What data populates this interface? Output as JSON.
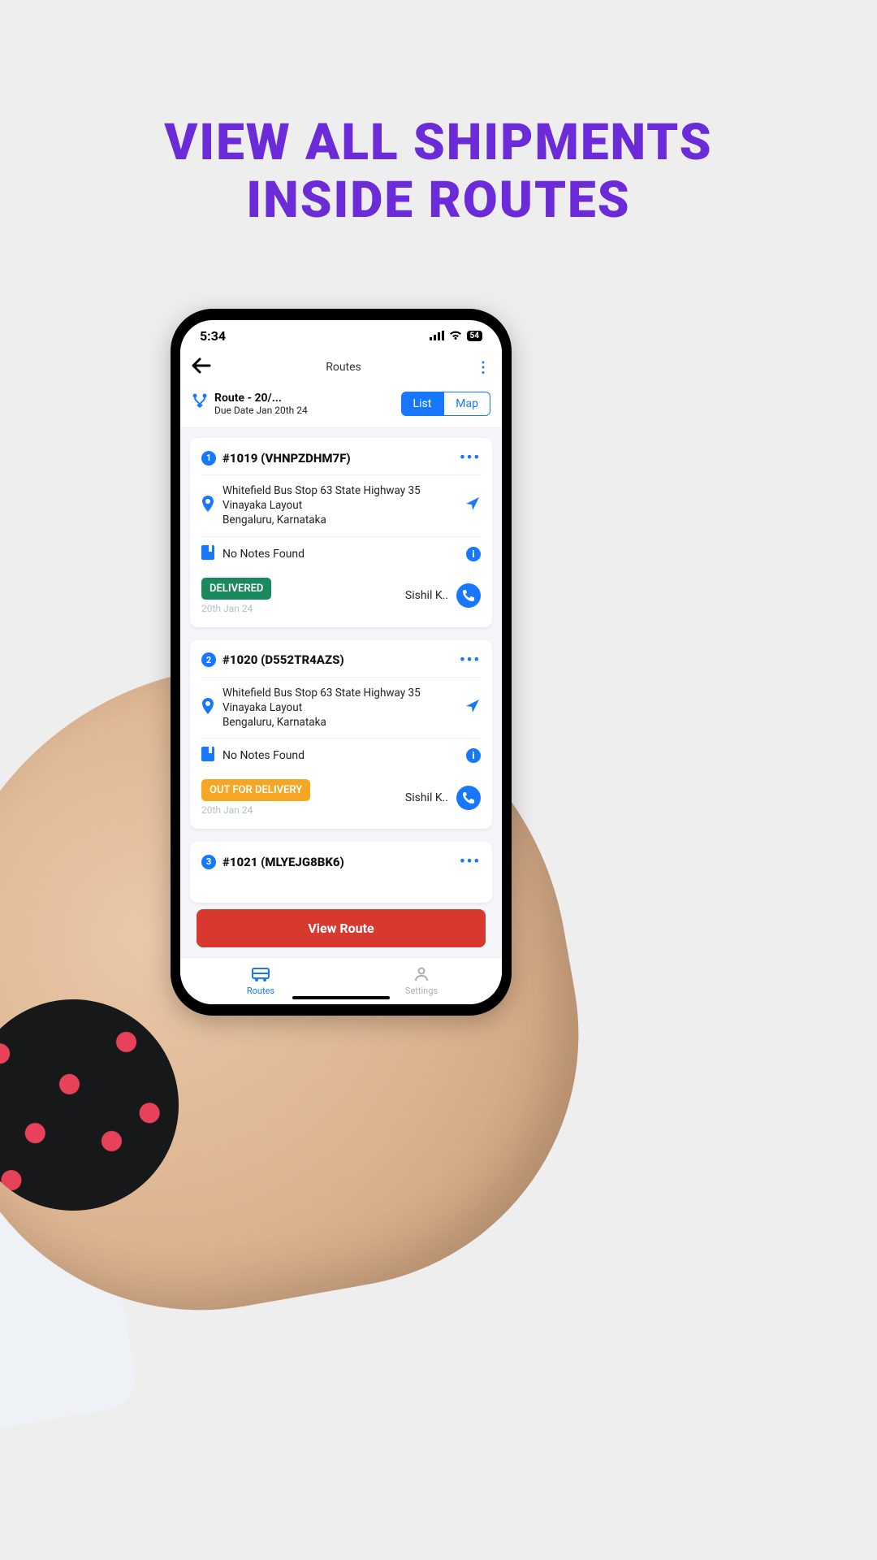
{
  "hero": {
    "line1": "VIEW ALL SHIPMENTS",
    "line2": "INSIDE ROUTES"
  },
  "status_bar": {
    "time": "5:34",
    "battery": "54"
  },
  "header": {
    "title": "Routes"
  },
  "route_summary": {
    "name": "Route - 20/...",
    "due": "Due Date Jan 20th 24"
  },
  "segmented": {
    "list": "List",
    "map": "Map"
  },
  "shipments": [
    {
      "index": "1",
      "title": "#1019 (VHNPZDHM7F)",
      "address_line1": "Whitefield Bus Stop 63 State Highway 35 Vinayaka Layout",
      "address_city": "Bengaluru, Karnataka",
      "notes": "No Notes Found",
      "status": "DELIVERED",
      "status_color": "green",
      "status_date": "20th Jan 24",
      "assignee": "Sishil K.."
    },
    {
      "index": "2",
      "title": "#1020 (D552TR4AZS)",
      "address_line1": "Whitefield Bus Stop 63 State Highway 35 Vinayaka Layout",
      "address_city": "Bengaluru, Karnataka",
      "notes": "No Notes Found",
      "status": "OUT FOR DELIVERY",
      "status_color": "orange",
      "status_date": "20th Jan 24",
      "assignee": "Sishil K.."
    },
    {
      "index": "3",
      "title": "#1021 (MLYEJG8BK6)"
    }
  ],
  "view_route_label": "View Route",
  "bottom_nav": {
    "routes": "Routes",
    "settings": "Settings"
  }
}
